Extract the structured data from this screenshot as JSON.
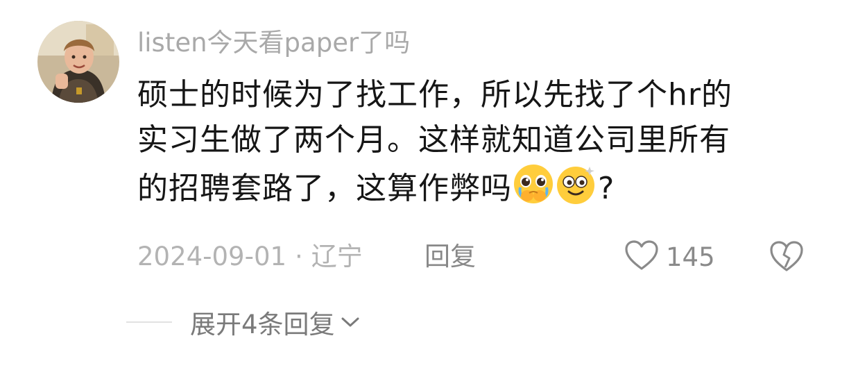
{
  "comment": {
    "username": "listen今天看paper了吗",
    "lines": [
      "硕士的时候为了找工作，所以先找了个hr的",
      "实习生做了两个月。这样就知道公司里所有",
      "的招聘套路了，这算作弊吗"
    ],
    "trailing_text": "?",
    "emojis": [
      "pleading-crying-face-emoji",
      "dizzy-smiling-face-emoji"
    ],
    "date": "2024-09-01",
    "separator": "·",
    "location": "辽宁",
    "reply_label": "回复",
    "like_count": "145",
    "icons": {
      "like": "heart-outline-icon",
      "dislike": "broken-heart-icon",
      "expand": "chevron-down-icon"
    }
  },
  "replies": {
    "expand_label": "展开4条回复"
  },
  "colors": {
    "username": "#a9a9a9",
    "body": "#161616",
    "meta": "#b3b3b3",
    "action": "#888888",
    "divider": "#e2e2e2"
  }
}
